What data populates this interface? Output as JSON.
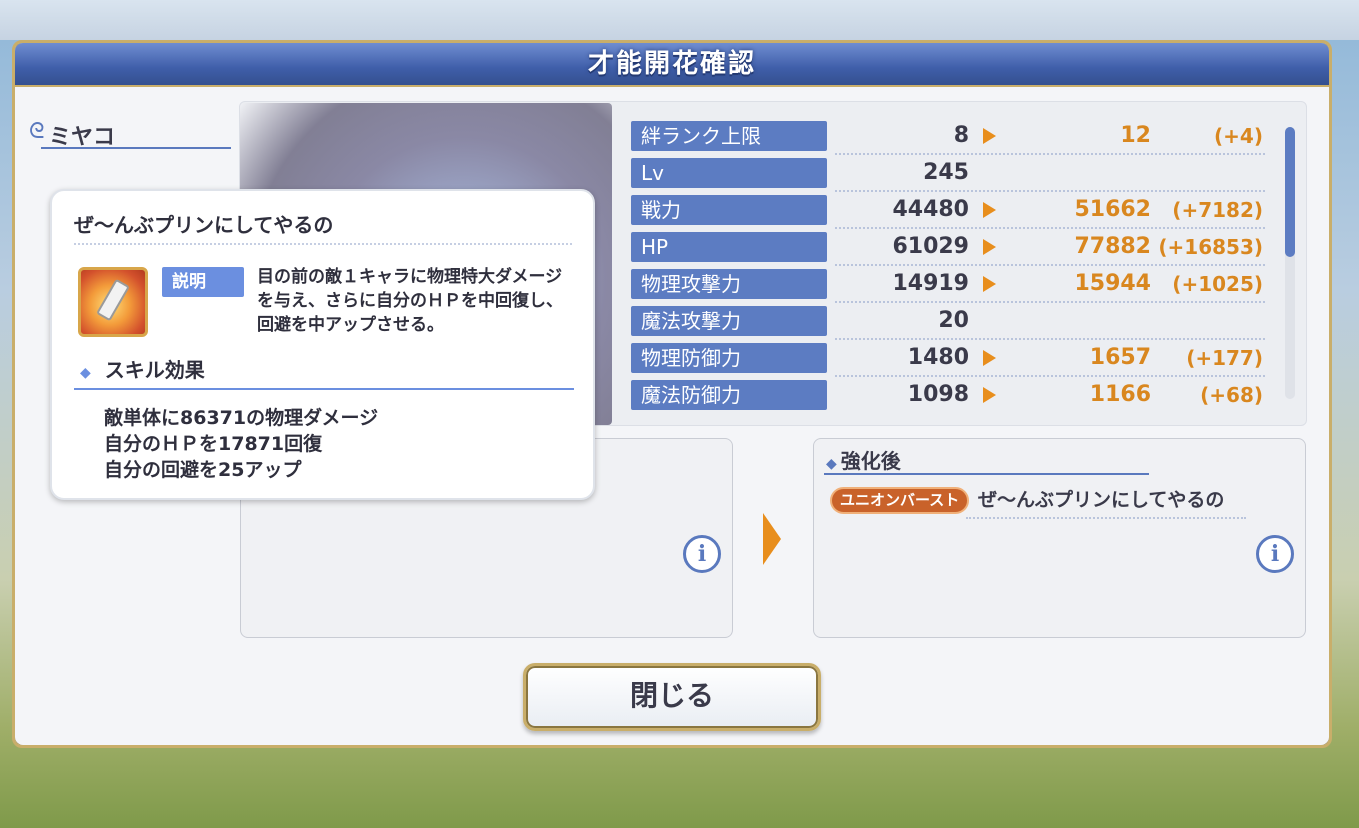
{
  "title": "才能開花確認",
  "character": {
    "name": "ミヤコ"
  },
  "stats": [
    {
      "label": "絆ランク上限",
      "current": "8",
      "new": "12",
      "diff": "(+4)"
    },
    {
      "label": "Lv",
      "current": "245",
      "new": "",
      "diff": ""
    },
    {
      "label": "戦力",
      "current": "44480",
      "new": "51662",
      "diff": "(+7182)"
    },
    {
      "label": "HP",
      "current": "61029",
      "new": "77882",
      "diff": "(+16853)"
    },
    {
      "label": "物理攻撃力",
      "current": "14919",
      "new": "15944",
      "diff": "(+1025)"
    },
    {
      "label": "魔法攻撃力",
      "current": "20",
      "new": "",
      "diff": ""
    },
    {
      "label": "物理防御力",
      "current": "1480",
      "new": "1657",
      "diff": "(+177)"
    },
    {
      "label": "魔法防御力",
      "current": "1098",
      "new": "1166",
      "diff": "(+68)"
    }
  ],
  "after": {
    "title": "強化後",
    "badge": "ユニオンバースト",
    "skill_name": "ぜ〜んぶプリンにしてやるの"
  },
  "close_button": "閉じる",
  "popup": {
    "title": "ぜ〜んぶプリンにしてやるの",
    "desc_label": "説明",
    "description": "目の前の敵１キャラに物理特大ダメージを与え、さらに自分のＨＰを中回復し、回避を中アップさせる。",
    "effect_title": "スキル効果",
    "effects": [
      "敵単体に86371の物理ダメージ",
      "自分のＨＰを17871回復",
      "自分の回避を25アップ"
    ]
  },
  "colors": {
    "accent_blue": "#5c7cc2",
    "gain_orange": "#d9871f",
    "frame_gold": "#c9ae6a"
  },
  "icons": {
    "info": "i"
  }
}
